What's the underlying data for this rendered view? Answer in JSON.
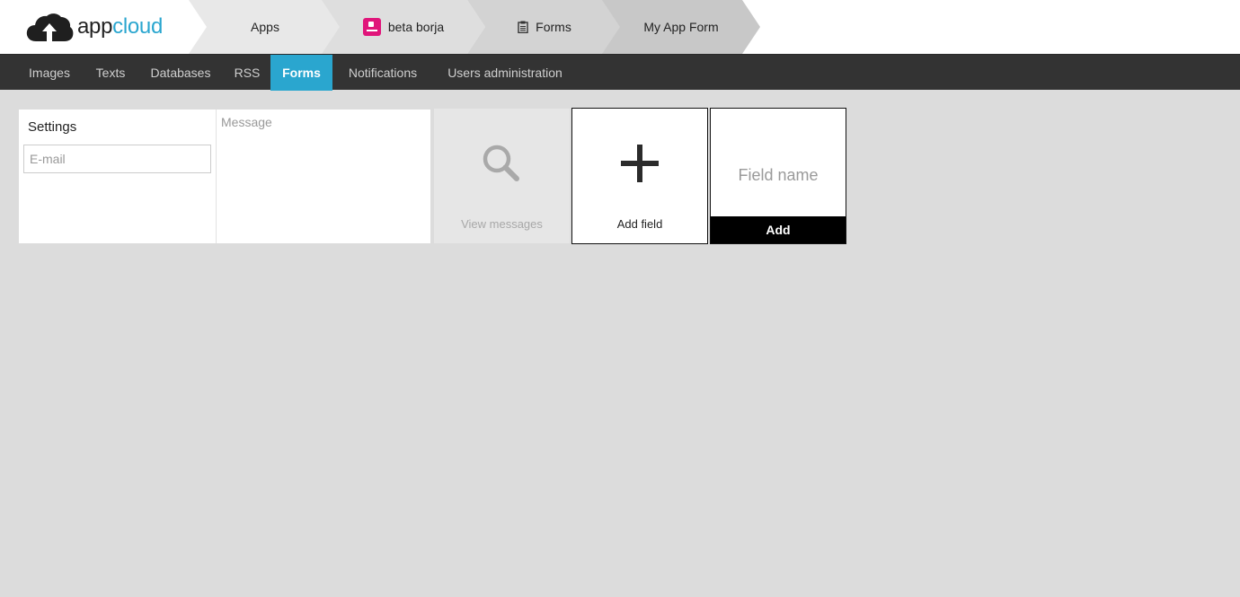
{
  "header": {
    "logo": {
      "part1": "app",
      "part2": "cloud",
      "icon": "cloud-upload-icon"
    },
    "breadcrumbs": [
      {
        "label": "Apps"
      },
      {
        "label": "beta borja",
        "icon": "app-badge-icon"
      },
      {
        "label": "Forms",
        "icon": "clipboard-icon"
      },
      {
        "label": "My App Form"
      }
    ]
  },
  "nav": {
    "items": [
      {
        "label": "Images"
      },
      {
        "label": "Texts"
      },
      {
        "label": "Databases"
      },
      {
        "label": "RSS"
      },
      {
        "label": "Forms",
        "active": true
      },
      {
        "label": "Notifications"
      },
      {
        "label": "Users administration"
      }
    ]
  },
  "form": {
    "settings_title": "Settings",
    "email_placeholder": "E-mail",
    "message_placeholder": "Message"
  },
  "tiles": {
    "view_messages": {
      "label": "View messages",
      "icon": "search-icon"
    },
    "add_field": {
      "label": "Add field",
      "icon": "plus-icon"
    },
    "new_field": {
      "placeholder": "Field name",
      "button_label": "Add"
    }
  },
  "colors": {
    "accent": "#2aa6cf",
    "nav_bg": "#333333",
    "page_bg": "#dcdcdc",
    "app_badge": "#e0157a"
  }
}
